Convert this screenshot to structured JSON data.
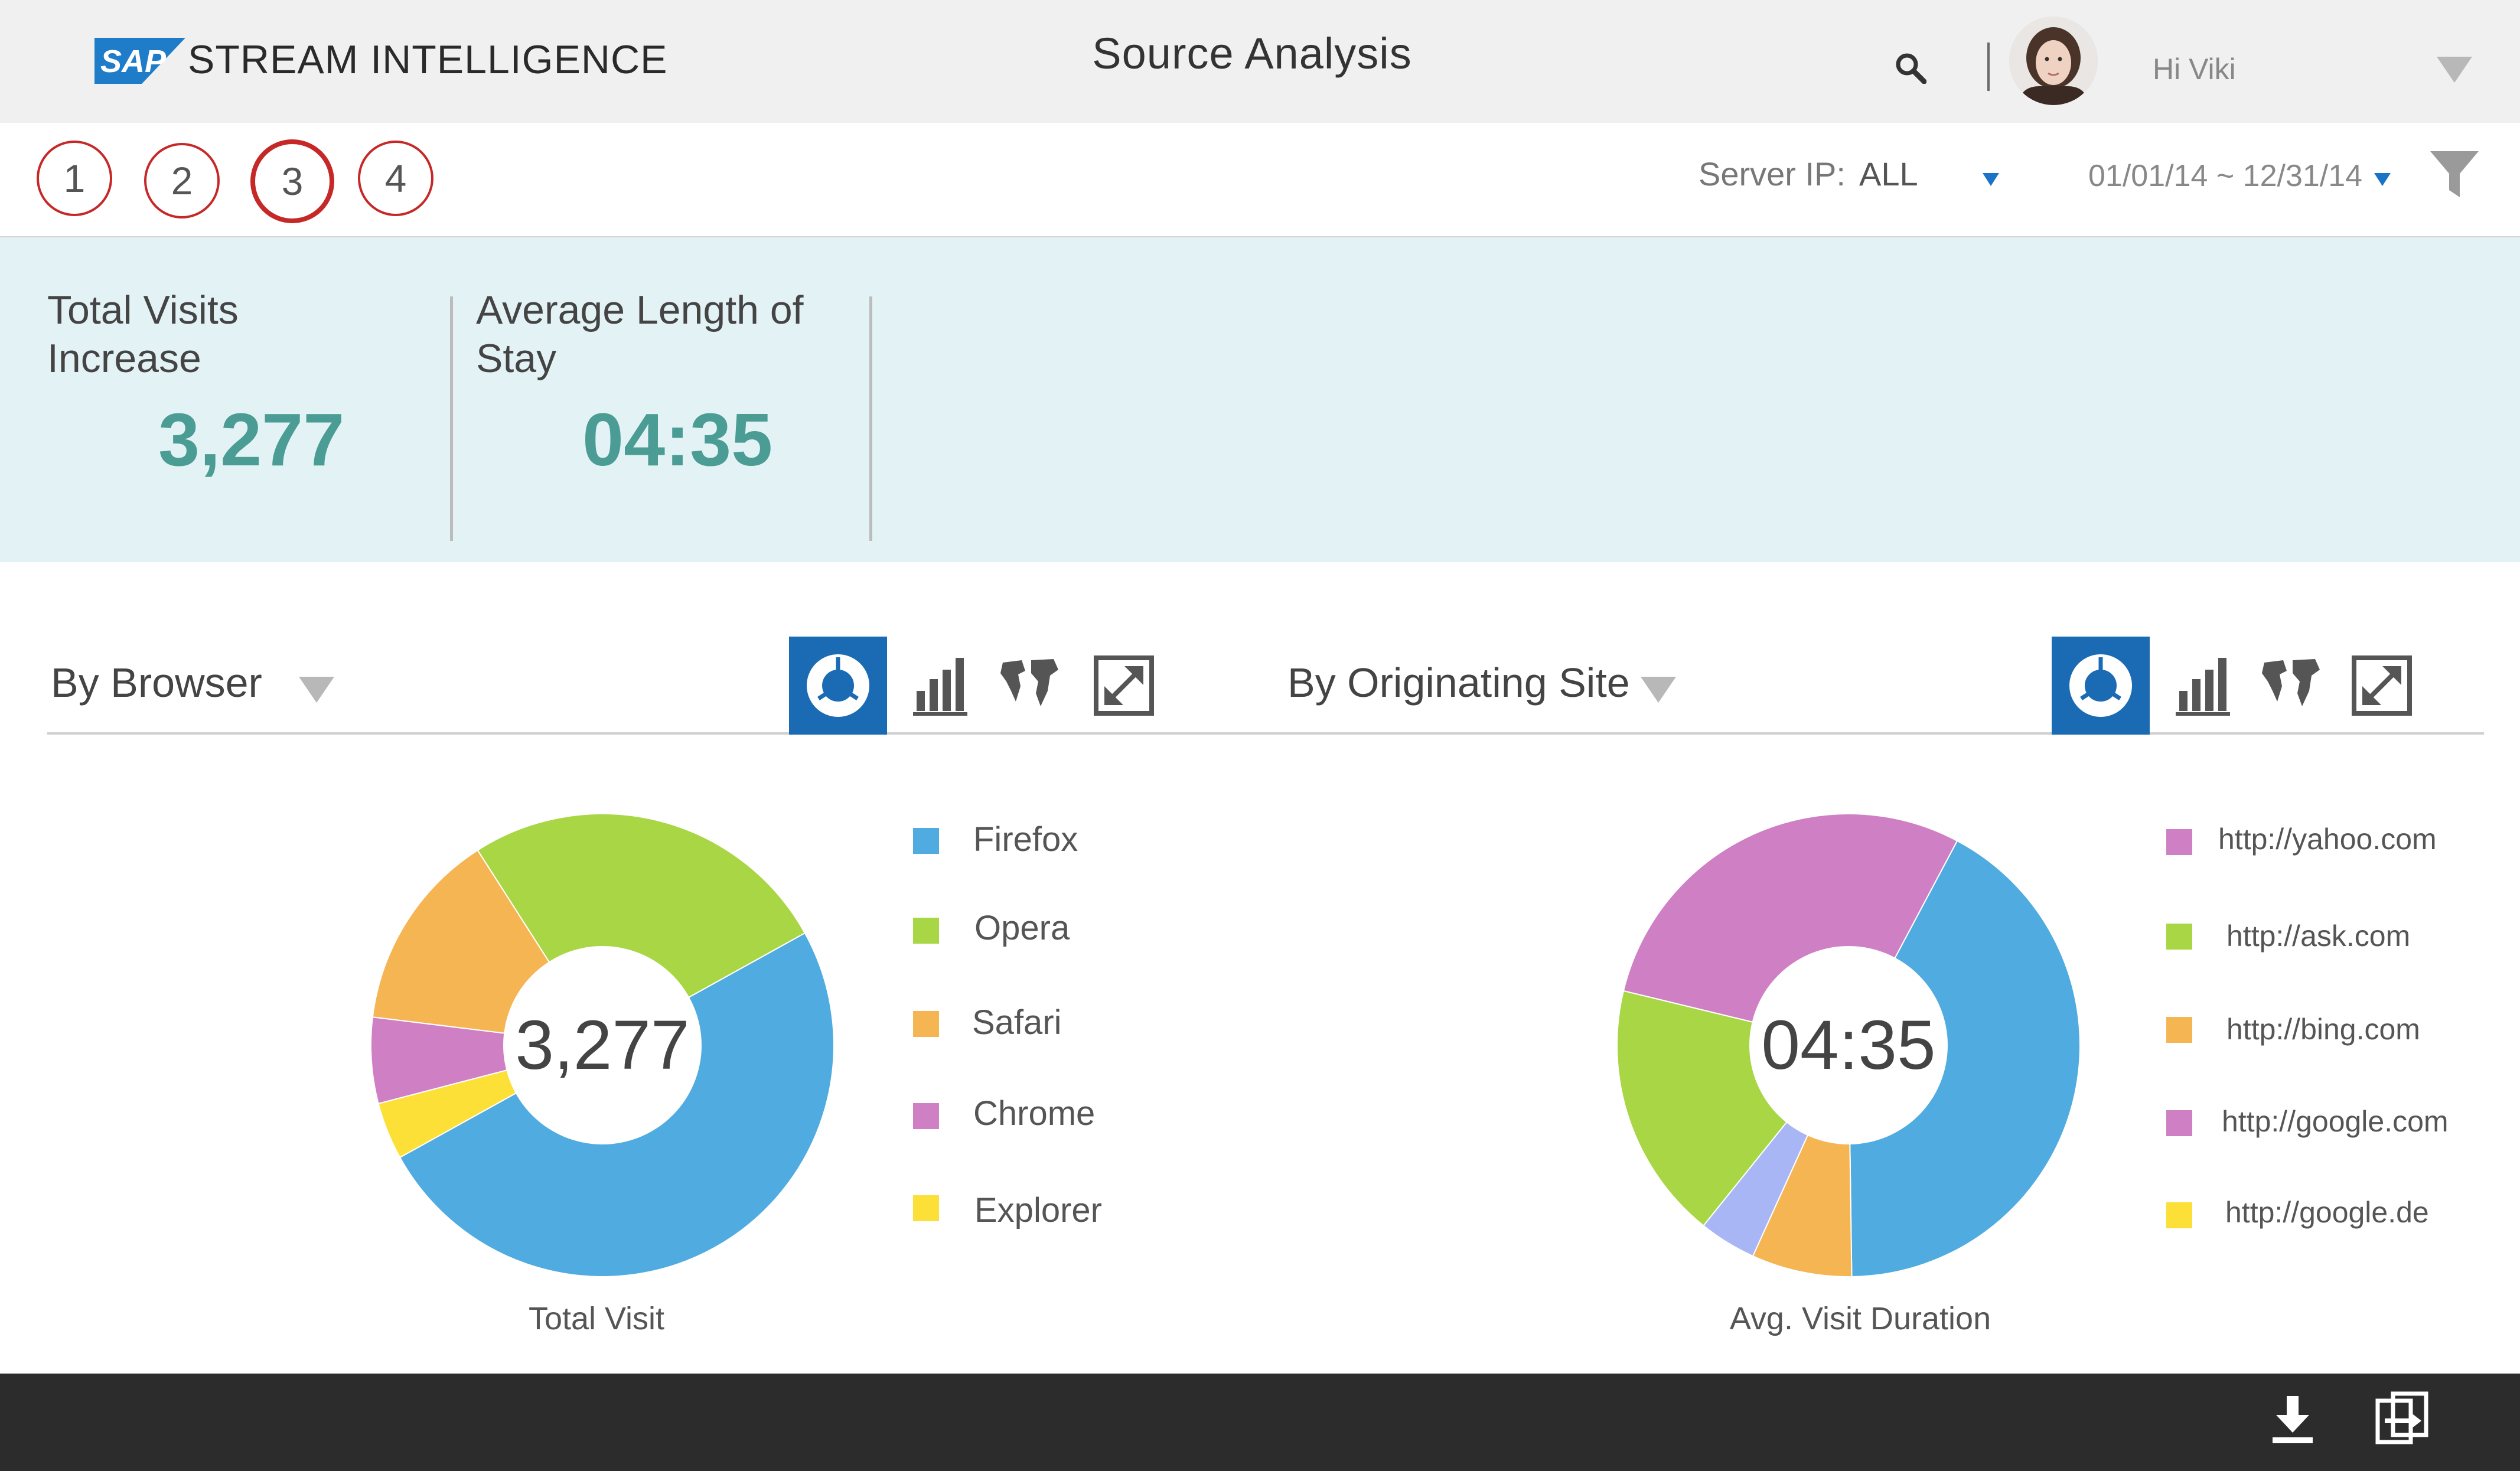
{
  "header": {
    "logo_text": "SAP",
    "brand": "STREAM INTELLIGENCE",
    "title": "Source Analysis",
    "greeting": "Hi Viki",
    "icons": {
      "search": "search-icon",
      "avatar": "user-avatar",
      "menu": "chevron-down-icon"
    }
  },
  "toolbar": {
    "steps": [
      "1",
      "2",
      "3",
      "4"
    ],
    "active_step": "3",
    "server_label": "Server IP:",
    "server_value": "ALL",
    "date_range": "01/01/14 ~ 12/31/14",
    "accent_color": "#c62828",
    "caret_color": "#1a73c7"
  },
  "kpis": [
    {
      "label_line1": "Total Visits",
      "label_line2": "Increase",
      "value": "3,277"
    },
    {
      "label_line1": "Average Length of",
      "label_line2": "Stay",
      "value": "04:35"
    }
  ],
  "sections": {
    "browser": {
      "title": "By Browser",
      "view_buttons": [
        "donut-chart-icon",
        "bar-chart-icon",
        "map-icon",
        "expand-icon"
      ],
      "active_view": "donut-chart-icon",
      "center_label": "3,277",
      "caption": "Total Visit",
      "legend": [
        "Firefox",
        "Opera",
        "Safari",
        "Chrome",
        "Explorer"
      ]
    },
    "site": {
      "title": "By Originating Site",
      "view_buttons": [
        "donut-chart-icon",
        "bar-chart-icon",
        "map-icon",
        "expand-icon"
      ],
      "active_view": "donut-chart-icon",
      "center_label": "04:35",
      "caption": "Avg. Visit Duration",
      "legend": [
        "http://yahoo.com",
        "http://ask.com",
        "http://bing.com",
        "http://google.com",
        "http://google.de"
      ]
    }
  },
  "footer": {
    "icons": [
      "download-icon",
      "export-icon"
    ]
  },
  "chart_data": [
    {
      "type": "pie",
      "categories": [
        "Firefox",
        "Opera",
        "Safari",
        "Chrome",
        "Explorer"
      ],
      "values": [
        50,
        26,
        14,
        6,
        4
      ],
      "colors": [
        "#4fabe0",
        "#a8d644",
        "#f5b552",
        "#cf7fc3",
        "#fde037"
      ],
      "center_label": "3,277",
      "caption": "Total Visit"
    },
    {
      "type": "pie",
      "categories": [
        "http://yahoo.com",
        "http://ask.com",
        "http://bing.com",
        "http://google.com",
        "http://google.de"
      ],
      "values": [
        29,
        18,
        7,
        4,
        42
      ],
      "segment_order": [
        "http://google.de",
        "http://bing.com",
        "other",
        "http://ask.com",
        "http://yahoo.com"
      ],
      "colors": [
        "#cf7fc3",
        "#a8d644",
        "#f5b552",
        "#a9b6f5",
        "#4fabe0"
      ],
      "center_label": "04:35",
      "caption": "Avg. Visit Duration"
    }
  ]
}
